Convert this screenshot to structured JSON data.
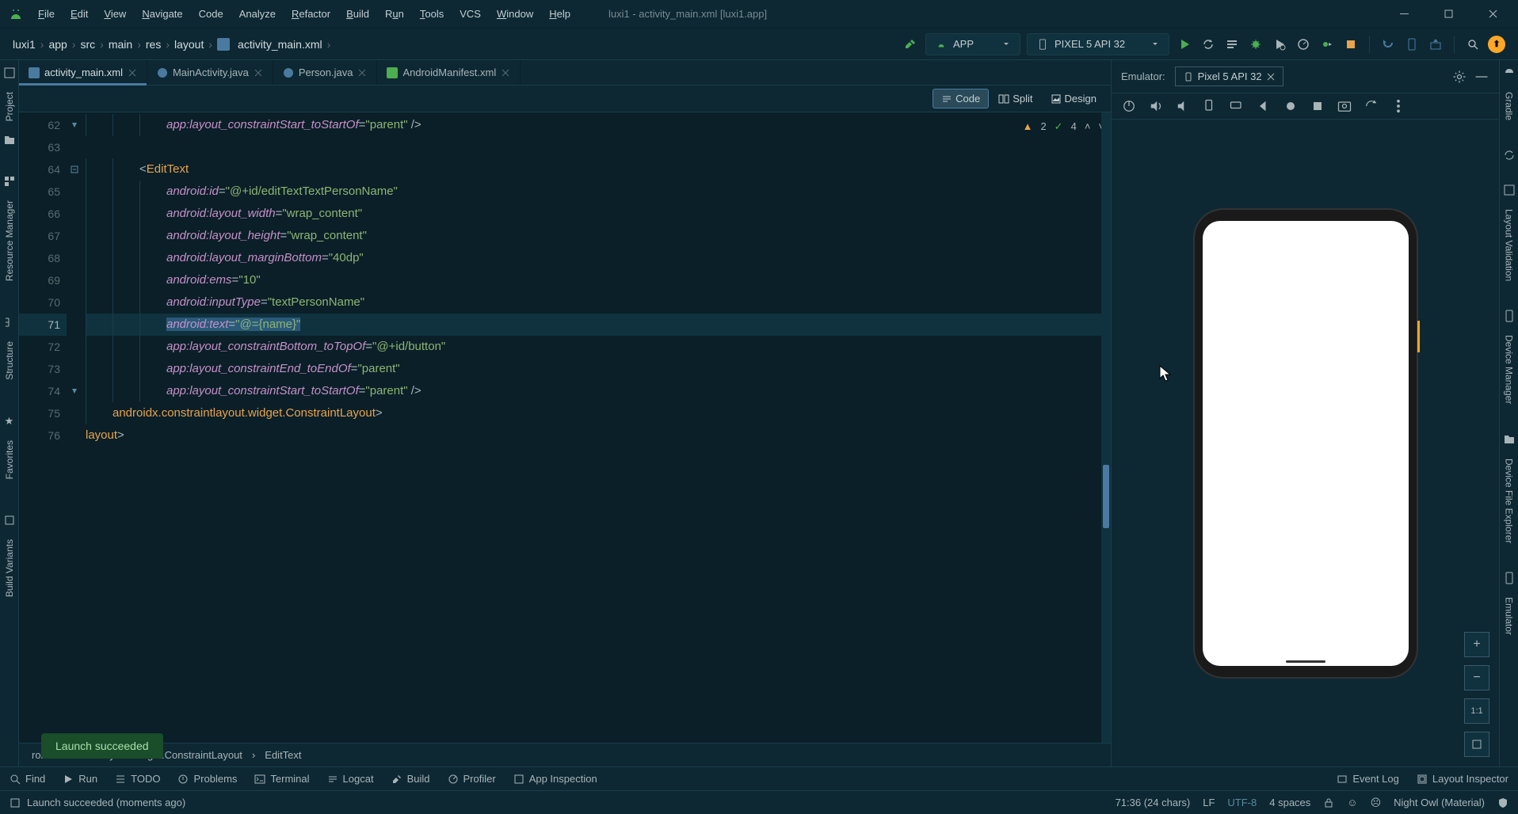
{
  "window": {
    "title": "luxi1 - activity_main.xml [luxi1.app]"
  },
  "menu": {
    "file": "File",
    "edit": "Edit",
    "view": "View",
    "navigate": "Navigate",
    "code": "Code",
    "analyze": "Analyze",
    "refactor": "Refactor",
    "build": "Build",
    "run": "Run",
    "tools": "Tools",
    "vcs": "VCS",
    "windowm": "Window",
    "help": "Help"
  },
  "breadcrumb": [
    "luxi1",
    "app",
    "src",
    "main",
    "res",
    "layout",
    "activity_main.xml"
  ],
  "run_config": {
    "label": "APP"
  },
  "device_select": {
    "label": "PIXEL 5 API 32"
  },
  "tabs": [
    {
      "label": "activity_main.xml",
      "active": true
    },
    {
      "label": "MainActivity.java",
      "active": false
    },
    {
      "label": "Person.java",
      "active": false
    },
    {
      "label": "AndroidManifest.xml",
      "active": false
    }
  ],
  "view_modes": {
    "code": "Code",
    "split": "Split",
    "design": "Design"
  },
  "inspections": {
    "warn_count": "2",
    "weak_count": "4"
  },
  "code": {
    "lines": [
      {
        "n": 62,
        "indent": 3,
        "parts": [
          [
            "attr",
            "app:layout_constraintStart_toStartOf"
          ],
          [
            "eq",
            "="
          ],
          [
            "str",
            "\"parent\""
          ],
          [
            "txt",
            " />"
          ]
        ]
      },
      {
        "n": 63,
        "indent": 0,
        "parts": []
      },
      {
        "n": 64,
        "indent": 2,
        "parts": [
          [
            "txt",
            "<"
          ],
          [
            "tag",
            "EditText"
          ]
        ]
      },
      {
        "n": 65,
        "indent": 3,
        "parts": [
          [
            "attr",
            "android:id"
          ],
          [
            "eq",
            "="
          ],
          [
            "str",
            "\"@+id/editTextTextPersonName\""
          ]
        ]
      },
      {
        "n": 66,
        "indent": 3,
        "parts": [
          [
            "attr",
            "android:layout_width"
          ],
          [
            "eq",
            "="
          ],
          [
            "str",
            "\"wrap_content\""
          ]
        ]
      },
      {
        "n": 67,
        "indent": 3,
        "parts": [
          [
            "attr",
            "android:layout_height"
          ],
          [
            "eq",
            "="
          ],
          [
            "str",
            "\"wrap_content\""
          ]
        ]
      },
      {
        "n": 68,
        "indent": 3,
        "parts": [
          [
            "attr",
            "android:layout_marginBottom"
          ],
          [
            "eq",
            "="
          ],
          [
            "str",
            "\"40dp\""
          ]
        ]
      },
      {
        "n": 69,
        "indent": 3,
        "parts": [
          [
            "attr",
            "android:ems"
          ],
          [
            "eq",
            "="
          ],
          [
            "str",
            "\"10\""
          ]
        ]
      },
      {
        "n": 70,
        "indent": 3,
        "parts": [
          [
            "attr",
            "android:inputType"
          ],
          [
            "eq",
            "="
          ],
          [
            "str",
            "\"textPersonName\""
          ]
        ]
      },
      {
        "n": 71,
        "indent": 3,
        "hl": true,
        "selected": true,
        "parts": [
          [
            "attr",
            "android:text"
          ],
          [
            "eq",
            "="
          ],
          [
            "str",
            "\"@={name}\""
          ]
        ]
      },
      {
        "n": 72,
        "indent": 3,
        "parts": [
          [
            "attr",
            "app:layout_constraintBottom_toTopOf"
          ],
          [
            "eq",
            "="
          ],
          [
            "str",
            "\"@+id/button\""
          ]
        ]
      },
      {
        "n": 73,
        "indent": 3,
        "parts": [
          [
            "attr",
            "app:layout_constraintEnd_toEndOf"
          ],
          [
            "eq",
            "="
          ],
          [
            "str",
            "\"parent\""
          ]
        ]
      },
      {
        "n": 74,
        "indent": 3,
        "parts": [
          [
            "attr",
            "app:layout_constraintStart_toStartOf"
          ],
          [
            "eq",
            "="
          ],
          [
            "str",
            "\"parent\""
          ],
          [
            "txt",
            " />"
          ]
        ]
      },
      {
        "n": 75,
        "indent": 1,
        "parts": [
          [
            "txt",
            "</"
          ],
          [
            "tag",
            "androidx.constraintlayout.widget.ConstraintLayout"
          ],
          [
            "txt",
            ">"
          ]
        ]
      },
      {
        "n": 76,
        "indent": 0,
        "parts": [
          [
            "txt",
            "</"
          ],
          [
            "tag",
            "layout"
          ],
          [
            "txt",
            ">"
          ]
        ]
      }
    ]
  },
  "code_crumb": [
    "roidx.constraintlayout.widget.ConstraintLayout",
    "EditText"
  ],
  "emulator": {
    "label": "Emulator:",
    "tab": "Pixel 5 API 32"
  },
  "left_rail": {
    "project": "Project",
    "resource_manager": "Resource Manager",
    "structure": "Structure",
    "favorites": "Favorites",
    "build_variants": "Build Variants"
  },
  "right_rail": {
    "gradle": "Gradle",
    "layout_validation": "Layout Validation",
    "device_manager": "Device Manager",
    "device_file_explorer": "Device File Explorer",
    "emulator": "Emulator"
  },
  "bottom": {
    "find": "Find",
    "run": "Run",
    "todo": "TODO",
    "problems": "Problems",
    "terminal": "Terminal",
    "logcat": "Logcat",
    "build": "Build",
    "profiler": "Profiler",
    "app_inspection": "App Inspection",
    "event_log": "Event Log",
    "layout_inspector": "Layout Inspector"
  },
  "toast": "Launch succeeded",
  "status": {
    "message": "Launch succeeded (moments ago)",
    "cursor": "71:36 (24 chars)",
    "line_sep": "LF",
    "encoding": "UTF-8",
    "indent": "4 spaces",
    "theme": "Night Owl (Material)"
  }
}
